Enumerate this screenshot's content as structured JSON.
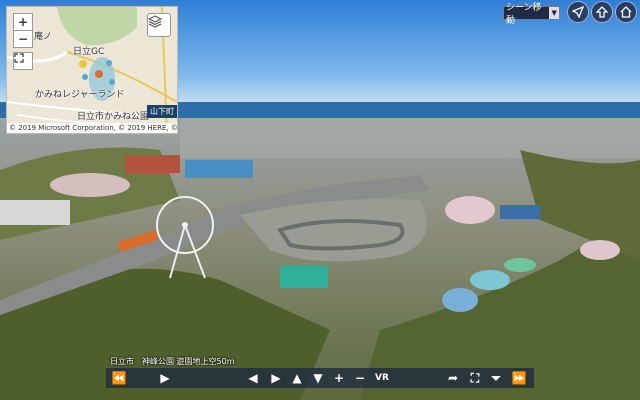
{
  "minimap": {
    "zoom_in_label": "+",
    "zoom_out_label": "−",
    "labels": {
      "tag_small": "庵ノ",
      "hitachi_gc": "日立GC",
      "kaminei_leisure": "かみねレジャーランド",
      "kaminei_park": "日立市かみね公園",
      "yamashita": "山下町"
    },
    "copyright": "© 2019 Microsoft Corporation, © 2019 HERE, © 2019 Zenrin",
    "icons": {
      "fullscreen": "fullscreen-icon",
      "layers": "layers-icon"
    }
  },
  "top_bar": {
    "scene_select": "シーン移動",
    "icons": [
      "navigation-icon",
      "upload-icon",
      "home-icon"
    ]
  },
  "caption": "日立市　神峰公園 遊園地上空50m",
  "toolbar": {
    "buttons": [
      {
        "name": "rewind-icon",
        "glyph": "⏪"
      },
      {
        "name": "play-icon",
        "glyph": "▶"
      },
      {
        "name": "arrow-left-icon",
        "glyph": "◀"
      },
      {
        "name": "arrow-right-icon",
        "glyph": "▶"
      },
      {
        "name": "arrow-up-icon",
        "glyph": "▲"
      },
      {
        "name": "arrow-down-icon",
        "glyph": "▼"
      },
      {
        "name": "zoom-in-icon",
        "glyph": "+"
      },
      {
        "name": "zoom-out-icon",
        "glyph": "−"
      },
      {
        "name": "vr-goggles-icon",
        "glyph": "VR"
      },
      {
        "name": "share-icon",
        "glyph": "➦"
      },
      {
        "name": "fullscreen-icon",
        "glyph": "⛶"
      },
      {
        "name": "hide-controls-icon",
        "glyph": "⏷"
      },
      {
        "name": "fast-forward-icon",
        "glyph": "⏩"
      }
    ]
  }
}
